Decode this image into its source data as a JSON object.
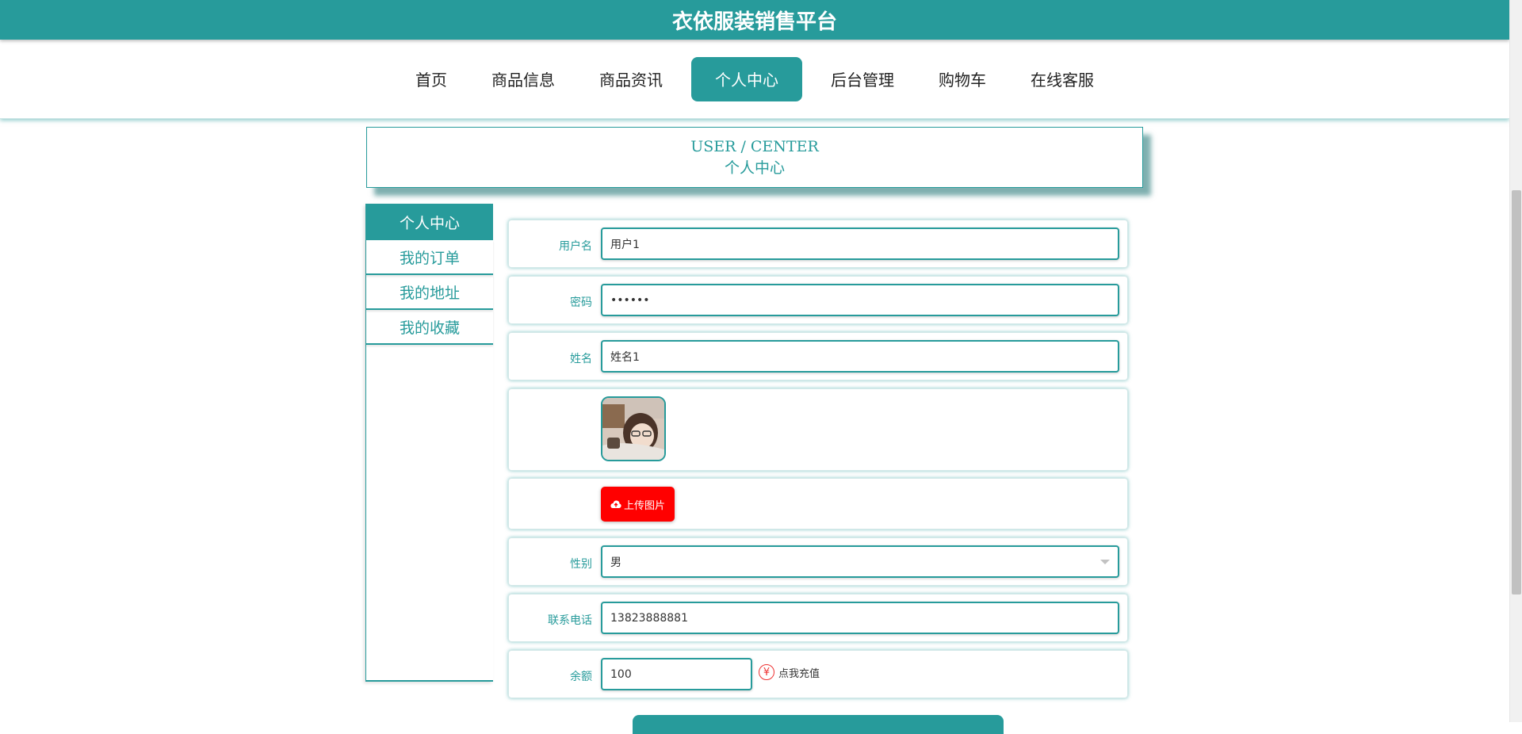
{
  "header": {
    "title": "衣依服装销售平台"
  },
  "nav": {
    "items": [
      {
        "label": "首页"
      },
      {
        "label": "商品信息"
      },
      {
        "label": "商品资讯"
      },
      {
        "label": "个人中心",
        "active": true
      },
      {
        "label": "后台管理"
      },
      {
        "label": "购物车"
      },
      {
        "label": "在线客服"
      }
    ]
  },
  "page_title": {
    "en": "USER / CENTER",
    "cn": "个人中心"
  },
  "sidebar": {
    "header": "个人中心",
    "items": [
      {
        "label": "我的订单"
      },
      {
        "label": "我的地址"
      },
      {
        "label": "我的收藏"
      }
    ]
  },
  "form": {
    "username": {
      "label": "用户名",
      "value": "用户1"
    },
    "password": {
      "label": "密码",
      "value": "••••••"
    },
    "name": {
      "label": "姓名",
      "value": "姓名1"
    },
    "upload": {
      "label": "上传图片"
    },
    "gender": {
      "label": "性别",
      "value": "男"
    },
    "phone": {
      "label": "联系电话",
      "value": "13823888881"
    },
    "balance": {
      "label": "余额",
      "value": "100",
      "recharge_label": "点我充值",
      "recharge_symbol": "¥"
    }
  },
  "colors": {
    "primary": "#279b9b",
    "upload": "#ff0000"
  }
}
